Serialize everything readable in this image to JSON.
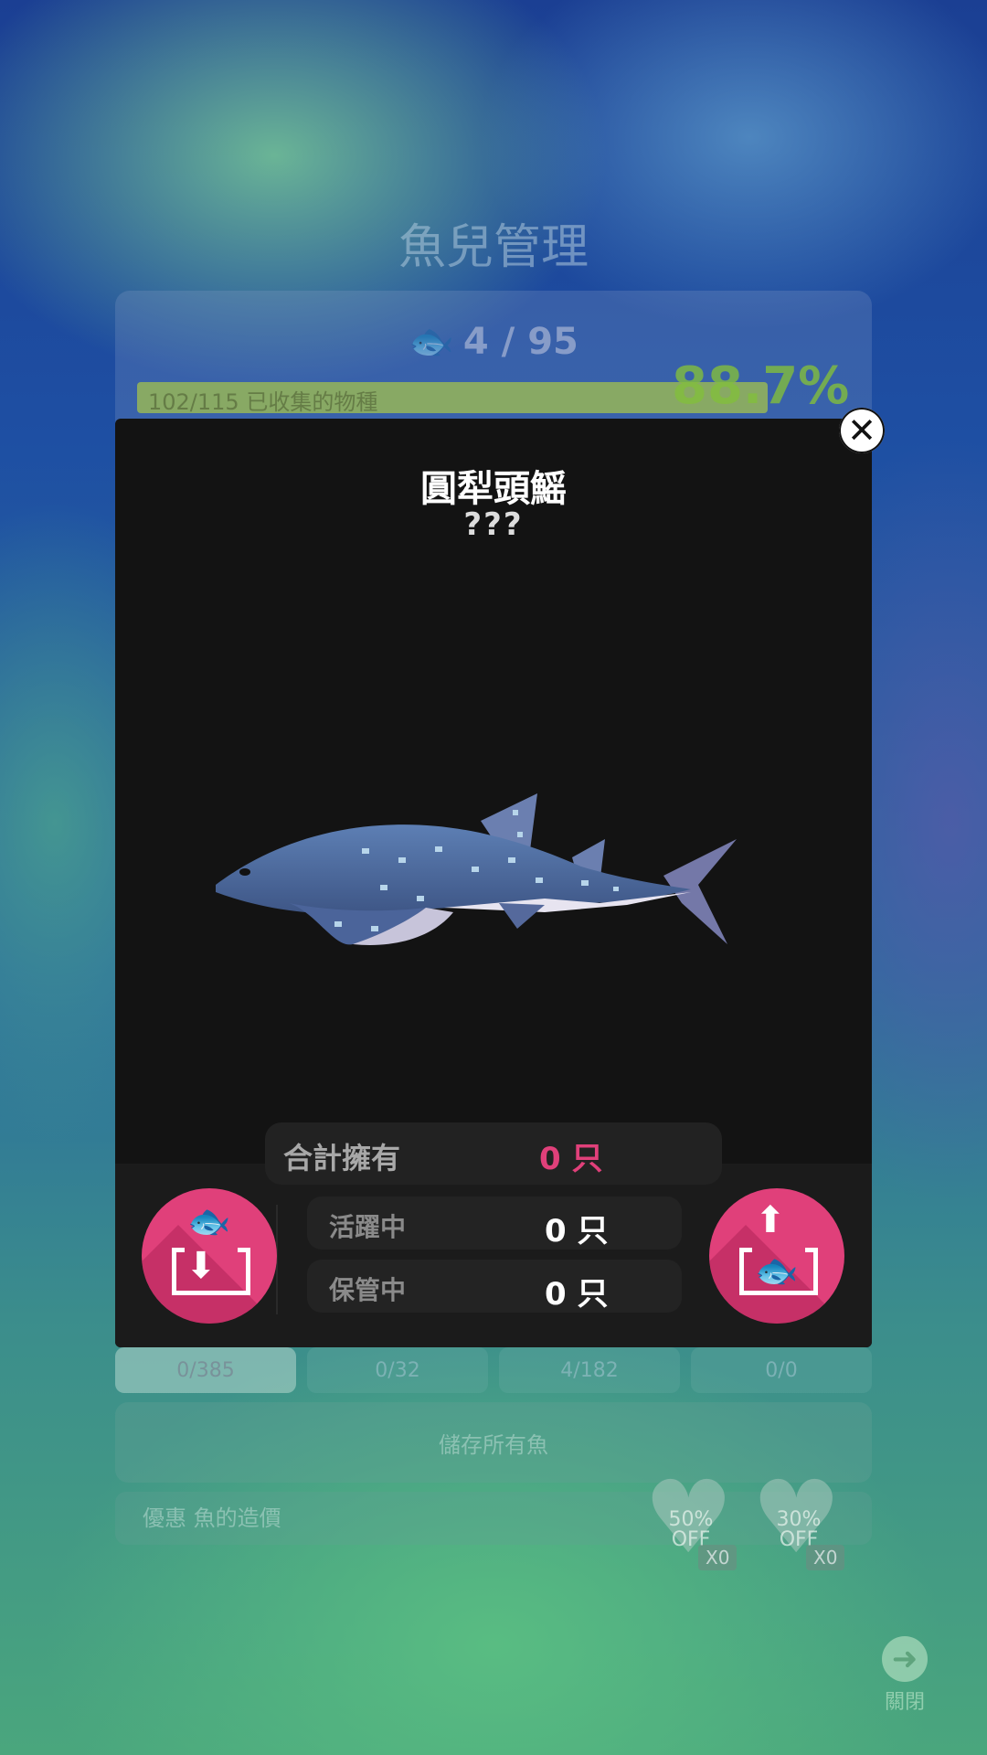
{
  "background": {
    "title": "魚兒管理",
    "fish_count": "4 / 95",
    "collection_text": "102/115 已收集的物種",
    "collection_percent": "88.7%",
    "collection_fill": 0.887,
    "tabs": [
      {
        "label": "0/385",
        "active": true
      },
      {
        "label": "0/32",
        "active": false
      },
      {
        "label": "4/182",
        "active": false
      },
      {
        "label": "0/0",
        "active": false
      }
    ],
    "save_all_label": "儲存所有魚",
    "discount_label": "優惠 魚的造價",
    "coupons": [
      {
        "line1": "50%",
        "line2": "OFF",
        "count": "X0"
      },
      {
        "line1": "30%",
        "line2": "OFF",
        "count": "X0"
      }
    ],
    "close_label": "關閉"
  },
  "modal": {
    "name": "圓犁頭鰩",
    "subtitle": "???",
    "total_label": "合計擁有",
    "total_value": "0 只",
    "active_label": "活躍中",
    "active_value": "0 只",
    "stored_label": "保管中",
    "stored_value": "0 只"
  },
  "icons": {
    "close": "close-icon",
    "store": "store-fish-icon",
    "release": "release-fish-icon",
    "fish": "fish-icon",
    "next": "arrow-right-circle-icon"
  },
  "colors": {
    "accent": "#e0407a",
    "modal_bg": "#131313",
    "progress": "#aac846"
  }
}
